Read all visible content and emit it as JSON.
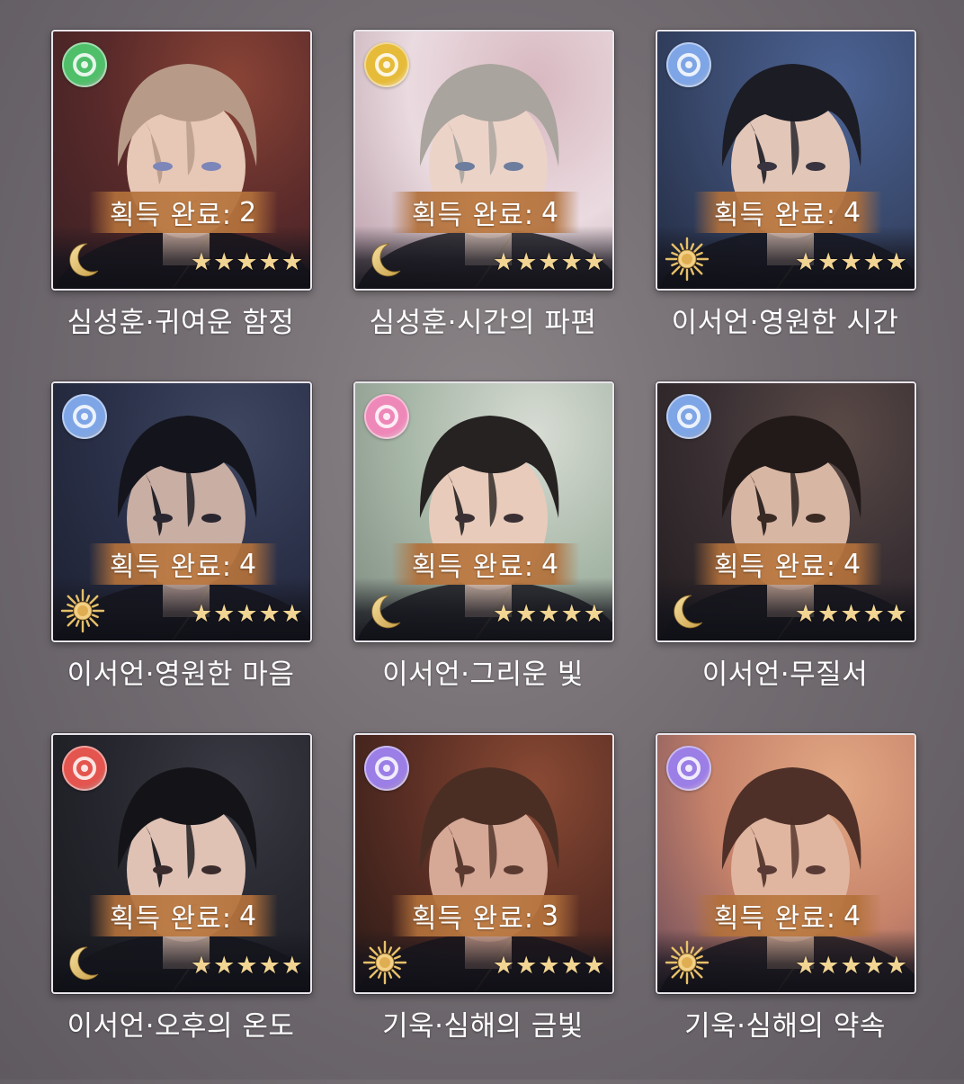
{
  "count_label": "획득 완료:",
  "cards": [
    {
      "title": "심성훈·귀여운 함정",
      "count": "2",
      "stars": 5,
      "attr_color": "#4fbf6a",
      "type_icon": "moon-icon",
      "bg": [
        "#5a2a2a",
        "#8a4436",
        "#3a2024"
      ],
      "hair": "#b79a88",
      "skin": "#e7c7b6",
      "eyes": "#7d86b8"
    },
    {
      "title": "심성훈·시간의 파편",
      "count": "4",
      "stars": 5,
      "attr_color": "#e6bb3a",
      "type_icon": "moon-icon",
      "bg": [
        "#eadbe0",
        "#d8b8c0",
        "#b89aa6"
      ],
      "hair": "#a9a49d",
      "skin": "#ecd3c8",
      "eyes": "#6d7d9e"
    },
    {
      "title": "이서언·영원한 시간",
      "count": "4",
      "stars": 5,
      "attr_color": "#7ea5e6",
      "type_icon": "sun-icon",
      "bg": [
        "#3a4a6e",
        "#4c6394",
        "#222a40"
      ],
      "hair": "#1c1c24",
      "skin": "#e2c6b8",
      "eyes": "#3a3440"
    },
    {
      "title": "이서언·영원한 마음",
      "count": "4",
      "stars": 5,
      "attr_color": "#7ea5e6",
      "type_icon": "sun-icon",
      "bg": [
        "#2a3048",
        "#3e4660",
        "#1c2030"
      ],
      "hair": "#14141c",
      "skin": "#c9aea4",
      "eyes": "#2a2630"
    },
    {
      "title": "이서언·그리운 빛",
      "count": "4",
      "stars": 5,
      "attr_color": "#ee88b8",
      "type_icon": "moon-icon",
      "bg": [
        "#a8b8a8",
        "#d8dcd4",
        "#7e8a80"
      ],
      "hair": "#262222",
      "skin": "#e8cbbb",
      "eyes": "#3a3034"
    },
    {
      "title": "이서언·무질서",
      "count": "4",
      "stars": 5,
      "attr_color": "#7ea5e6",
      "type_icon": "moon-icon",
      "bg": [
        "#3a3034",
        "#5a4a46",
        "#221c1e"
      ],
      "hair": "#221a18",
      "skin": "#d8b6a4",
      "eyes": "#3a2a24"
    },
    {
      "title": "이서언·오후의 온도",
      "count": "4",
      "stars": 5,
      "attr_color": "#e3554e",
      "type_icon": "moon-icon",
      "bg": [
        "#26262e",
        "#3a3a44",
        "#18181e"
      ],
      "hair": "#141418",
      "skin": "#e0c2b4",
      "eyes": "#3a2c2c"
    },
    {
      "title": "기욱·심해의 금빛",
      "count": "3",
      "stars": 5,
      "attr_color": "#9b7ee6",
      "type_icon": "sun-icon",
      "bg": [
        "#5a2e24",
        "#8a4a34",
        "#2a1a16"
      ],
      "hair": "#4a2e24",
      "skin": "#d6a896",
      "eyes": "#5a3a30"
    },
    {
      "title": "기욱·심해의 약속",
      "count": "4",
      "stars": 5,
      "attr_color": "#9b7ee6",
      "type_icon": "sun-icon",
      "bg": [
        "#c6826a",
        "#e2a884",
        "#6a4a5a"
      ],
      "hair": "#4e3028",
      "skin": "#e0b6a0",
      "eyes": "#5a3a34"
    }
  ]
}
